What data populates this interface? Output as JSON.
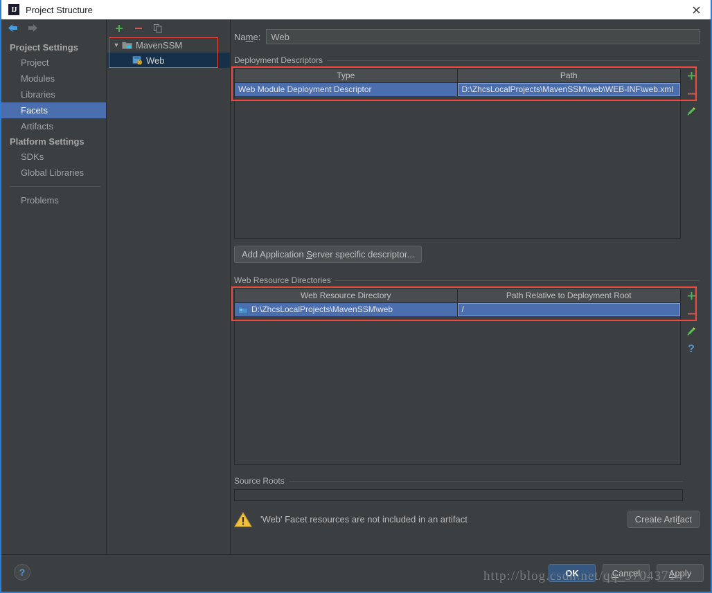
{
  "window": {
    "title": "Project Structure",
    "logo_text": "IJ",
    "close_icon": "close-icon"
  },
  "sidebar": {
    "back_icon": "arrow-back-icon",
    "forward_icon": "arrow-forward-icon",
    "groups": [
      {
        "label": "Project Settings",
        "items": [
          "Project",
          "Modules",
          "Libraries",
          "Facets",
          "Artifacts"
        ]
      },
      {
        "label": "Platform Settings",
        "items": [
          "SDKs",
          "Global Libraries"
        ]
      }
    ],
    "selected": "Facets",
    "extra_items": [
      "Problems"
    ]
  },
  "tree": {
    "toolbar": [
      {
        "name": "add-facet-button",
        "glyph": "+"
      },
      {
        "name": "remove-facet-button",
        "glyph": "–"
      },
      {
        "name": "copy-facet-button",
        "glyph": "copy"
      }
    ],
    "nodes": [
      {
        "label": "MavenSSM",
        "icon": "module-icon",
        "expanded": true,
        "level": 0
      },
      {
        "label": "Web",
        "icon": "web-facet-icon",
        "level": 1,
        "selected": true
      }
    ]
  },
  "main": {
    "name_label_pre": "Na",
    "name_label_mnemonic": "m",
    "name_label_post": "e:",
    "name_value": "Web",
    "name_placeholder": "",
    "deployment": {
      "section_title": "Deployment Descriptors",
      "columns": [
        "Type",
        "Path"
      ],
      "rows": [
        {
          "type": "Web Module Deployment Descriptor",
          "path": "D:\\ZhcsLocalProjects\\MavenSSM\\web\\WEB-INF\\web.xml"
        }
      ],
      "side_buttons": [
        {
          "name": "add-descriptor-button",
          "glyph": "+"
        },
        {
          "name": "remove-descriptor-button",
          "glyph": "–"
        },
        {
          "name": "edit-descriptor-button",
          "glyph": "pencil"
        }
      ]
    },
    "add_server_descriptor": {
      "pre": "Add Application ",
      "mnemonic": "S",
      "post": "erver specific descriptor..."
    },
    "web_resources": {
      "section_title": "Web Resource Directories",
      "columns": [
        "Web Resource Directory",
        "Path Relative to Deployment Root"
      ],
      "rows": [
        {
          "directory": "D:\\ZhcsLocalProjects\\MavenSSM\\web",
          "relative_path": "/",
          "icon": "folder-icon"
        }
      ],
      "side_buttons": [
        {
          "name": "add-web-resource-button",
          "glyph": "+"
        },
        {
          "name": "remove-web-resource-button",
          "glyph": "–"
        },
        {
          "name": "edit-web-resource-button",
          "glyph": "pencil"
        },
        {
          "name": "help-web-resource-button",
          "glyph": "?"
        }
      ]
    },
    "source_roots": {
      "section_title": "Source Roots",
      "rows": []
    },
    "warning": {
      "icon": "warning-icon",
      "text": "'Web' Facet resources are not included in an artifact",
      "action_pre": "Create Arti",
      "action_mnemonic": "f",
      "action_post": "act"
    }
  },
  "footer": {
    "help_icon": "help-icon",
    "buttons": [
      {
        "name": "ok-button",
        "label": "OK",
        "primary": true
      },
      {
        "name": "cancel-button",
        "pre": "",
        "mnemonic": "C",
        "post": "ancel",
        "label": "Cancel"
      },
      {
        "name": "apply-button",
        "pre": "",
        "mnemonic": "A",
        "post": "pply",
        "label": "Apply"
      }
    ]
  },
  "watermark": {
    "text": "http://blog.csdn.net/qq_37043714"
  },
  "colors": {
    "window_bg": "#3c3f41",
    "selection_blue": "#4b6eaf",
    "accent_border_blue": "#2d7fd4",
    "highlight_red": "#f04a3c",
    "primary_button": "#365880",
    "add_green": "#4caf50",
    "remove_red": "#cf5b56",
    "help_blue": "#5394d4",
    "warning_yellow": "#e8b33c"
  }
}
